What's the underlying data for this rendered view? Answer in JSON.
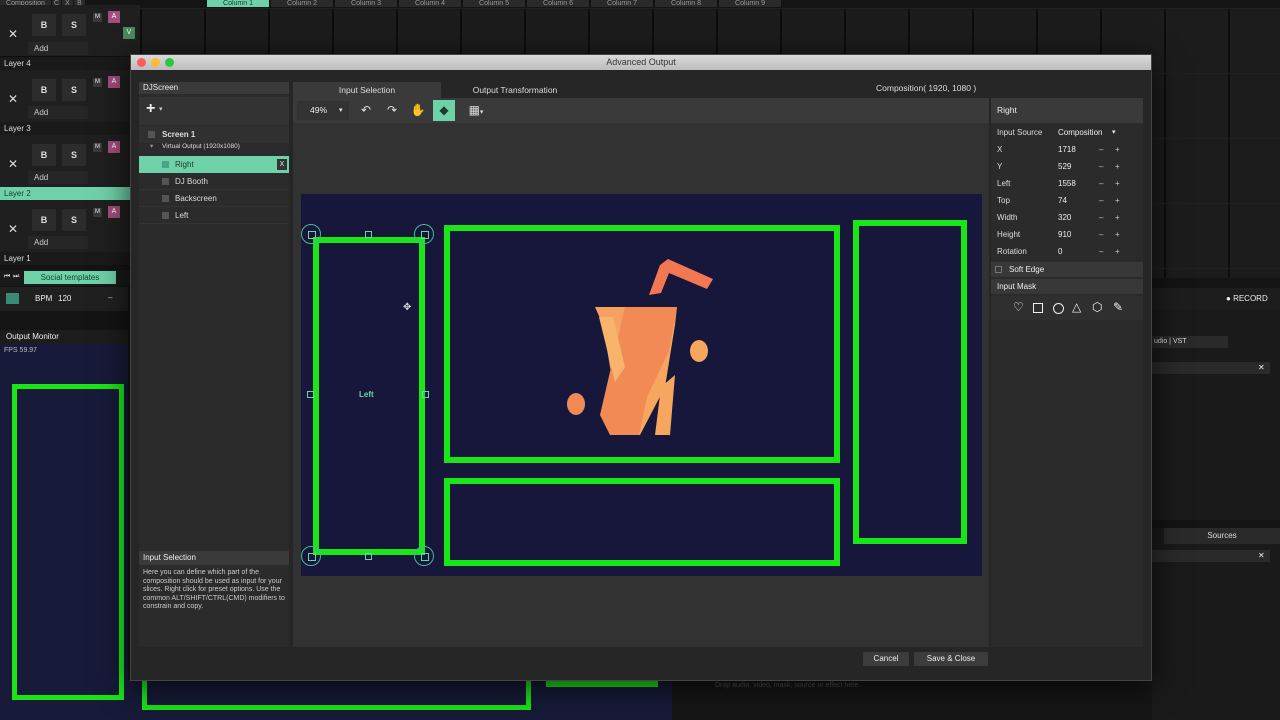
{
  "host": {
    "columns": [
      "Composition",
      "C",
      "X",
      "B",
      "Column 1",
      "Column 2",
      "Column 3",
      "Column 4",
      "Column 5",
      "Column 6",
      "Column 7",
      "Column 8",
      "Column 9"
    ],
    "layers": [
      {
        "name": "Layer 4",
        "add": "Add"
      },
      {
        "name": "Layer 3",
        "add": "Add"
      },
      {
        "name": "Layer 2",
        "add": "Add"
      },
      {
        "name": "Layer 1",
        "add": "Add"
      }
    ],
    "b_label": "B",
    "s_label": "S",
    "m_label": "M",
    "a_label": "A",
    "v_label": "V",
    "social_templates": "Social templates",
    "bpm_label": "BPM",
    "bpm_value": "120",
    "output_monitor": "Output Monitor",
    "fps": "FPS 59.97",
    "record": "RECORD",
    "audio_vst": "udio | VST",
    "sources": "Sources",
    "drop_hint": "Drop audio, video, mask, source or effect here."
  },
  "dialog": {
    "title": "Advanced Output",
    "screen_name": "DJScreen",
    "tabs": [
      "Input Selection",
      "Output Transformation"
    ],
    "composition_size": "Composition( 1920, 1080 )",
    "zoom": "49%",
    "tree": {
      "screen": "Screen 1",
      "virtual_output": "Virtual Output (1920x1080)",
      "slices": [
        "Right",
        "DJ Booth",
        "Backscreen",
        "Left"
      ],
      "selected_close": "X"
    },
    "help_title": "Input Selection",
    "help_text": "Here you can define which part of the composition should be used as input for your slices. Right click for preset options. Use the common ALT/SHIFT/CTRL(CMD) modifiers to constrain and copy.",
    "canvas_label": "Left",
    "inspector": {
      "title": "Right",
      "input_source_label": "Input Source",
      "input_source_value": "Composition",
      "props": [
        {
          "label": "X",
          "value": "1718"
        },
        {
          "label": "Y",
          "value": "529"
        },
        {
          "label": "Left",
          "value": "1558"
        },
        {
          "label": "Top",
          "value": "74"
        },
        {
          "label": "Width",
          "value": "320"
        },
        {
          "label": "Height",
          "value": "910"
        },
        {
          "label": "Rotation",
          "value": "0"
        }
      ],
      "minus": "–",
      "plus": "+",
      "soft_edge": "Soft Edge",
      "input_mask": "Input Mask"
    },
    "buttons": {
      "cancel": "Cancel",
      "save": "Save & Close"
    }
  }
}
